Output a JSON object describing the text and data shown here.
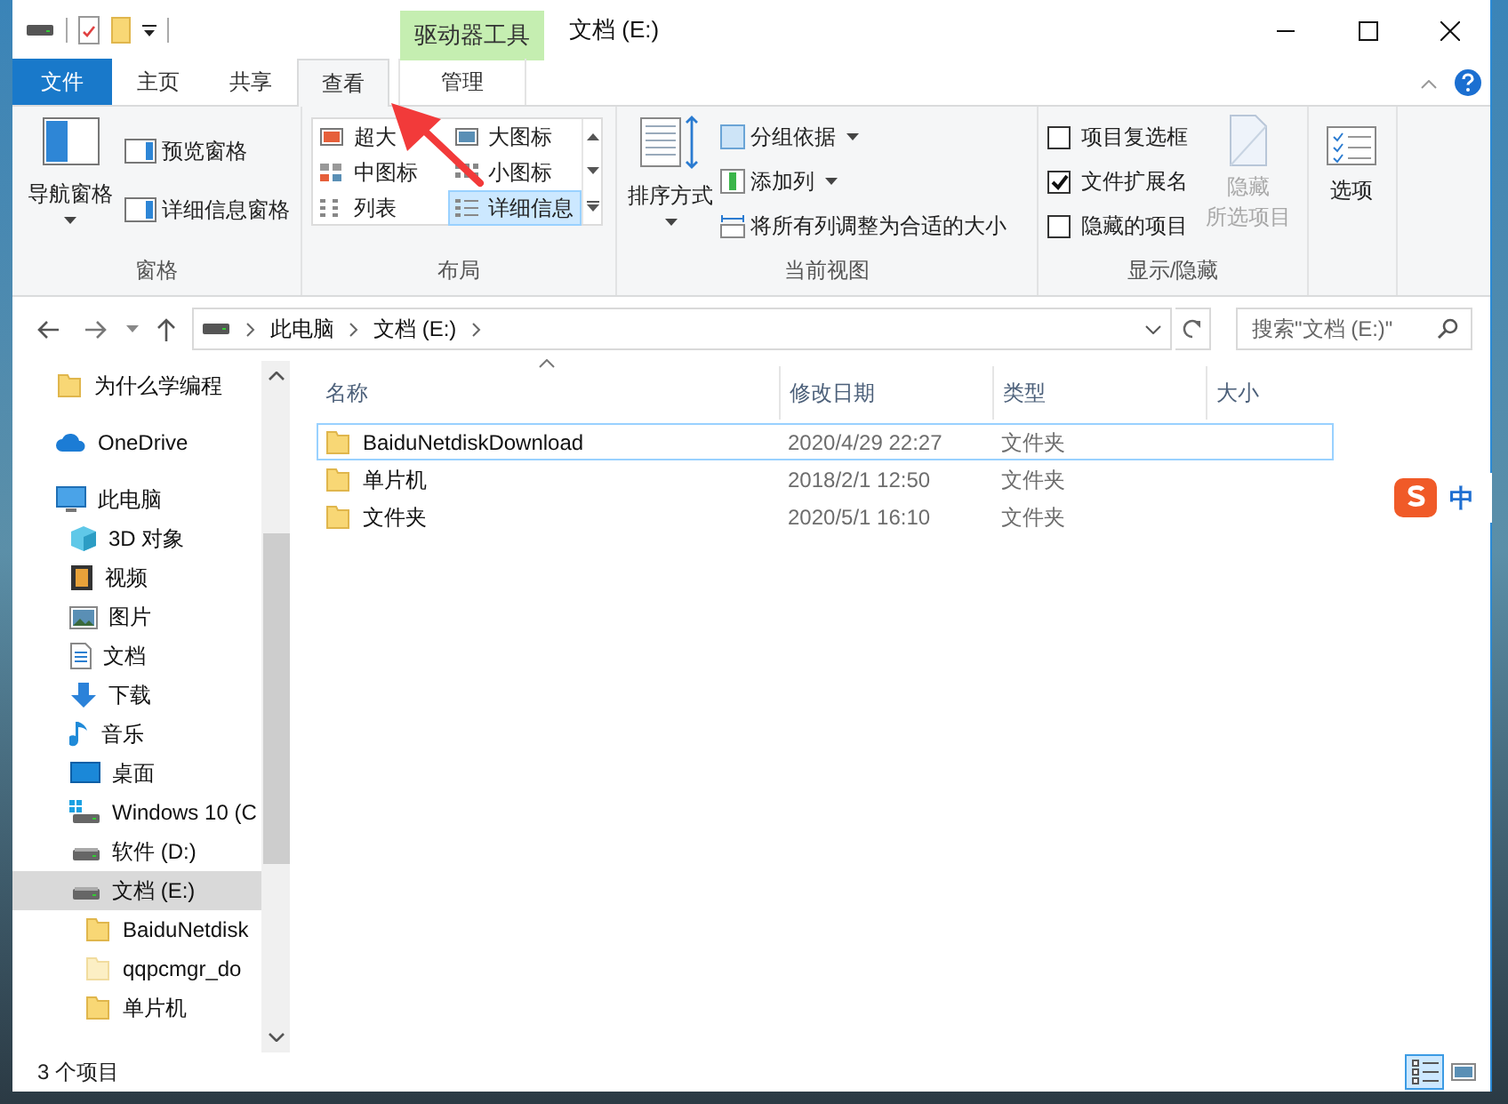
{
  "window": {
    "title": "文档 (E:)",
    "context_tab": "驱动器工具"
  },
  "ribbon_tabs": [
    {
      "label": "文件",
      "kind": "file",
      "selected": false
    },
    {
      "label": "主页",
      "kind": "normal",
      "selected": false
    },
    {
      "label": "共享",
      "kind": "normal",
      "selected": false
    },
    {
      "label": "查看",
      "kind": "normal",
      "selected": true
    },
    {
      "label": "管理",
      "kind": "context",
      "selected": false
    }
  ],
  "ribbon": {
    "panes": {
      "title": "窗格",
      "navigation_pane": "导航窗格",
      "preview_pane": "预览窗格",
      "details_pane": "详细信息窗格"
    },
    "layout": {
      "title": "布局",
      "options": [
        {
          "label": "超大",
          "kind": "extra-large",
          "selected": false
        },
        {
          "label": "大图标",
          "kind": "large",
          "selected": false
        },
        {
          "label": "中图标",
          "kind": "medium",
          "selected": false
        },
        {
          "label": "小图标",
          "kind": "small",
          "selected": false
        },
        {
          "label": "列表",
          "kind": "list",
          "selected": false
        },
        {
          "label": "详细信息",
          "kind": "details",
          "selected": true
        }
      ]
    },
    "current_view": {
      "title": "当前视图",
      "sort_by": "排序方式",
      "group_by": "分组依据",
      "add_columns": "添加列",
      "size_all_columns": "将所有列调整为合适的大小"
    },
    "show_hide": {
      "title": "显示/隐藏",
      "checkboxes": [
        {
          "label": "项目复选框",
          "checked": false
        },
        {
          "label": "文件扩展名",
          "checked": true
        },
        {
          "label": "隐藏的项目",
          "checked": false
        }
      ],
      "hide_selected": {
        "lines": [
          "隐藏",
          "所选项目"
        ],
        "disabled": true
      }
    },
    "options": {
      "label": "选项"
    }
  },
  "address_bar": {
    "crumbs": [
      "此电脑",
      "文档 (E:)"
    ]
  },
  "search": {
    "placeholder": "搜索\"文档 (E:)\""
  },
  "nav_pane": {
    "items": [
      {
        "label": "为什么学编程",
        "kind": "folder",
        "selected": false
      },
      {
        "label": "OneDrive",
        "kind": "cloud",
        "selected": false
      },
      {
        "label": "此电脑",
        "kind": "pc",
        "selected": false,
        "children": [
          {
            "label": "3D 对象",
            "kind": "cube",
            "selected": false
          },
          {
            "label": "视频",
            "kind": "video",
            "selected": false
          },
          {
            "label": "图片",
            "kind": "picture",
            "selected": false
          },
          {
            "label": "文档",
            "kind": "doc",
            "selected": false
          },
          {
            "label": "下载",
            "kind": "download",
            "selected": false
          },
          {
            "label": "音乐",
            "kind": "music",
            "selected": false
          },
          {
            "label": "桌面",
            "kind": "desktop",
            "selected": false
          },
          {
            "label": "Windows 10 (C",
            "kind": "drive-win",
            "selected": false
          },
          {
            "label": "软件 (D:)",
            "kind": "drive",
            "selected": false
          },
          {
            "label": "文档 (E:)",
            "kind": "drive",
            "selected": true,
            "children": [
              {
                "label": "BaiduNetdisk",
                "kind": "folder",
                "selected": false
              },
              {
                "label": "qqpcmgr_do",
                "kind": "folder-hidden",
                "selected": false
              },
              {
                "label": "单片机",
                "kind": "folder",
                "selected": false
              }
            ]
          }
        ]
      }
    ]
  },
  "file_list": {
    "columns": [
      "名称",
      "修改日期",
      "类型",
      "大小"
    ],
    "rows": [
      {
        "cells": [
          "BaiduNetdiskDownload",
          "2020/4/29 22:27",
          "文件夹"
        ],
        "focused": true
      },
      {
        "cells": [
          "单片机",
          "2018/2/1 12:50",
          "文件夹"
        ],
        "focused": false
      },
      {
        "cells": [
          "文件夹",
          "2020/5/1 16:10",
          "文件夹"
        ],
        "focused": false
      }
    ]
  },
  "status_bar": {
    "item_count": "3 个项目",
    "views": [
      {
        "kind": "details",
        "selected": true
      },
      {
        "kind": "large-icons",
        "selected": false
      }
    ]
  },
  "ime_indicator": {
    "label": "中"
  }
}
